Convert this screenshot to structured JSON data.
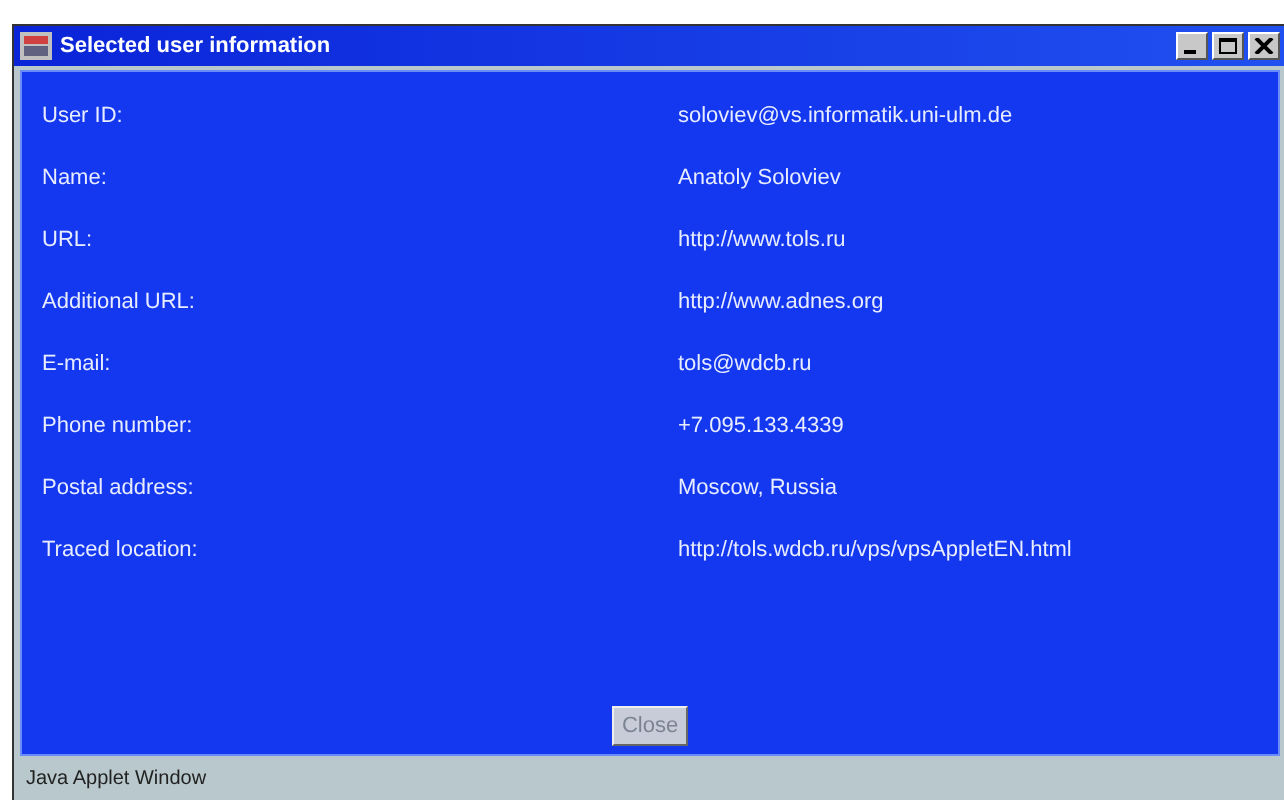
{
  "window": {
    "title": "Selected user information"
  },
  "fields": [
    {
      "label": "User ID:",
      "value": "soloviev@vs.informatik.uni-ulm.de"
    },
    {
      "label": "Name:",
      "value": "Anatoly Soloviev"
    },
    {
      "label": "URL:",
      "value": "http://www.tols.ru"
    },
    {
      "label": "Additional URL:",
      "value": "http://www.adnes.org"
    },
    {
      "label": "E-mail:",
      "value": "tols@wdcb.ru"
    },
    {
      "label": "Phone number:",
      "value": "+7.095.133.4339"
    },
    {
      "label": "Postal address:",
      "value": "Moscow, Russia"
    },
    {
      "label": "Traced location:",
      "value": "http://tols.wdcb.ru/vps/vpsAppletEN.html"
    }
  ],
  "buttons": [
    "Close"
  ],
  "status_bar": "Java Applet Window"
}
